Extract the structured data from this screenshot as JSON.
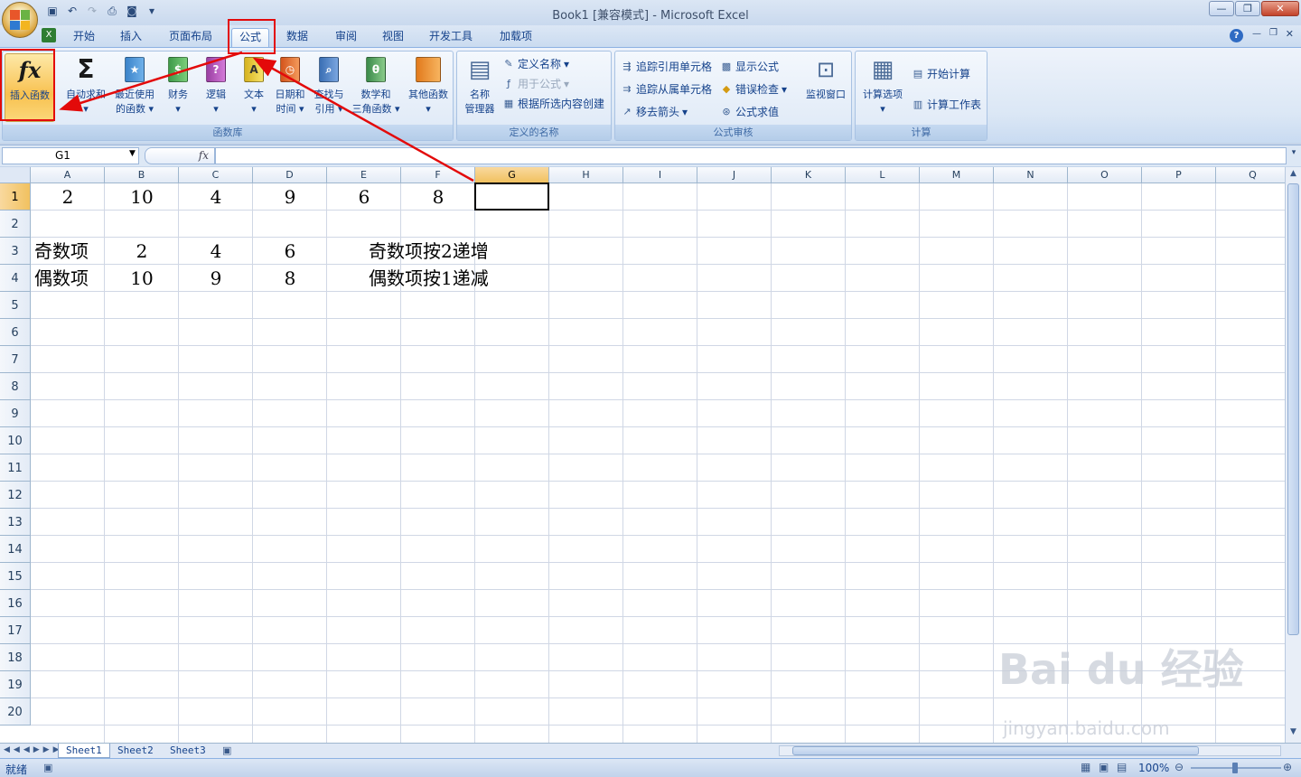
{
  "window": {
    "title": "Book1  [兼容模式] - Microsoft Excel"
  },
  "tabs": [
    {
      "label": "开始"
    },
    {
      "label": "插入"
    },
    {
      "label": "页面布局"
    },
    {
      "label": "公式"
    },
    {
      "label": "数据"
    },
    {
      "label": "审阅"
    },
    {
      "label": "视图"
    },
    {
      "label": "开发工具"
    },
    {
      "label": "加载项"
    }
  ],
  "ribbon": {
    "function_library": {
      "label": "函数库",
      "insert_function": "插入函数",
      "autosum": "自动求和",
      "recent_1": "最近使用",
      "recent_2": "的函数",
      "financial": "财务",
      "logical": "逻辑",
      "text": "文本",
      "datetime_1": "日期和",
      "datetime_2": "时间",
      "lookup_1": "查找与",
      "lookup_2": "引用",
      "math_1": "数学和",
      "math_2": "三角函数",
      "more": "其他函数"
    },
    "defined_names": {
      "label": "定义的名称",
      "name_manager_1": "名称",
      "name_manager_2": "管理器",
      "define_name": "定义名称",
      "use_in_formula": "用于公式",
      "create_from_selection": "根据所选内容创建"
    },
    "auditing": {
      "label": "公式审核",
      "trace_precedents": "追踪引用单元格",
      "trace_dependents": "追踪从属单元格",
      "remove_arrows": "移去箭头",
      "show_formulas": "显示公式",
      "error_checking": "错误检查",
      "evaluate_formula": "公式求值",
      "watch_window": "监视窗口"
    },
    "calculation": {
      "label": "计算",
      "calc_options": "计算选项",
      "calc_now": "开始计算",
      "calc_sheet": "计算工作表"
    }
  },
  "formula_bar": {
    "name_box": "G1",
    "fx": "fx",
    "formula": ""
  },
  "columns": [
    "A",
    "B",
    "C",
    "D",
    "E",
    "F",
    "G",
    "H",
    "I",
    "J",
    "K",
    "L",
    "M",
    "N",
    "O",
    "P",
    "Q"
  ],
  "rows": [
    "1",
    "2",
    "3",
    "4",
    "5",
    "6",
    "7",
    "8",
    "9",
    "10",
    "11",
    "12",
    "13",
    "14",
    "15",
    "16",
    "17",
    "18",
    "19",
    "20"
  ],
  "cells": {
    "A1": "2",
    "B1": "10",
    "C1": "4",
    "D1": "9",
    "E1": "6",
    "F1": "8",
    "A3": "奇数项",
    "B3": "2",
    "C3": "4",
    "D3": "6",
    "E3": "奇数项按2递增",
    "A4": "偶数项",
    "B4": "10",
    "C4": "9",
    "D4": "8",
    "E4": "偶数项按1递减"
  },
  "sheet_tabs": [
    "Sheet1",
    "Sheet2",
    "Sheet3"
  ],
  "status": {
    "ready": "就绪",
    "zoom": "100%"
  },
  "watermark": {
    "main": "Bai du 经验",
    "url": "jingyan.baidu.com"
  },
  "colors": {
    "accent": "#e30a0a",
    "selected_header": "#f1c15f",
    "ribbon": "#dbe7f5"
  }
}
